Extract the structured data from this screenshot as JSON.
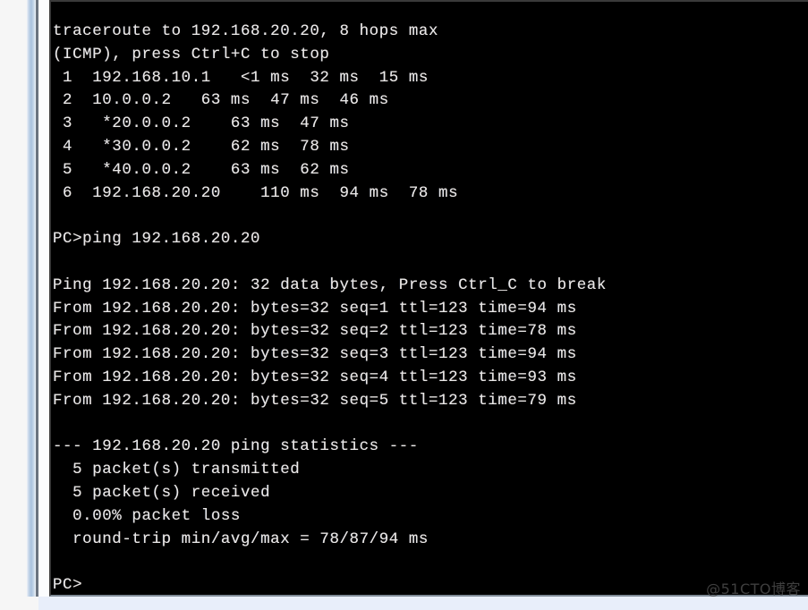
{
  "terminal": {
    "prompt_symbol": "PC>",
    "text_color": "#e8e8e8",
    "background_color": "#000000",
    "lines": [
      "traceroute to 192.168.20.20, 8 hops max",
      "(ICMP), press Ctrl+C to stop",
      " 1  192.168.10.1   <1 ms  32 ms  15 ms",
      " 2  10.0.0.2   63 ms  47 ms  46 ms",
      " 3   *20.0.0.2    63 ms  47 ms",
      " 4   *30.0.0.2    62 ms  78 ms",
      " 5   *40.0.0.2    63 ms  62 ms",
      " 6  192.168.20.20    110 ms  94 ms  78 ms",
      "",
      "PC>ping 192.168.20.20",
      "",
      "Ping 192.168.20.20: 32 data bytes, Press Ctrl_C to break",
      "From 192.168.20.20: bytes=32 seq=1 ttl=123 time=94 ms",
      "From 192.168.20.20: bytes=32 seq=2 ttl=123 time=78 ms",
      "From 192.168.20.20: bytes=32 seq=3 ttl=123 time=94 ms",
      "From 192.168.20.20: bytes=32 seq=4 ttl=123 time=93 ms",
      "From 192.168.20.20: bytes=32 seq=5 ttl=123 time=79 ms",
      "",
      "--- 192.168.20.20 ping statistics ---",
      "  5 packet(s) transmitted",
      "  5 packet(s) received",
      "  0.00% packet loss",
      "  round-trip min/avg/max = 78/87/94 ms",
      "",
      "PC>"
    ]
  },
  "watermark": {
    "text": "@51CTO博客"
  }
}
